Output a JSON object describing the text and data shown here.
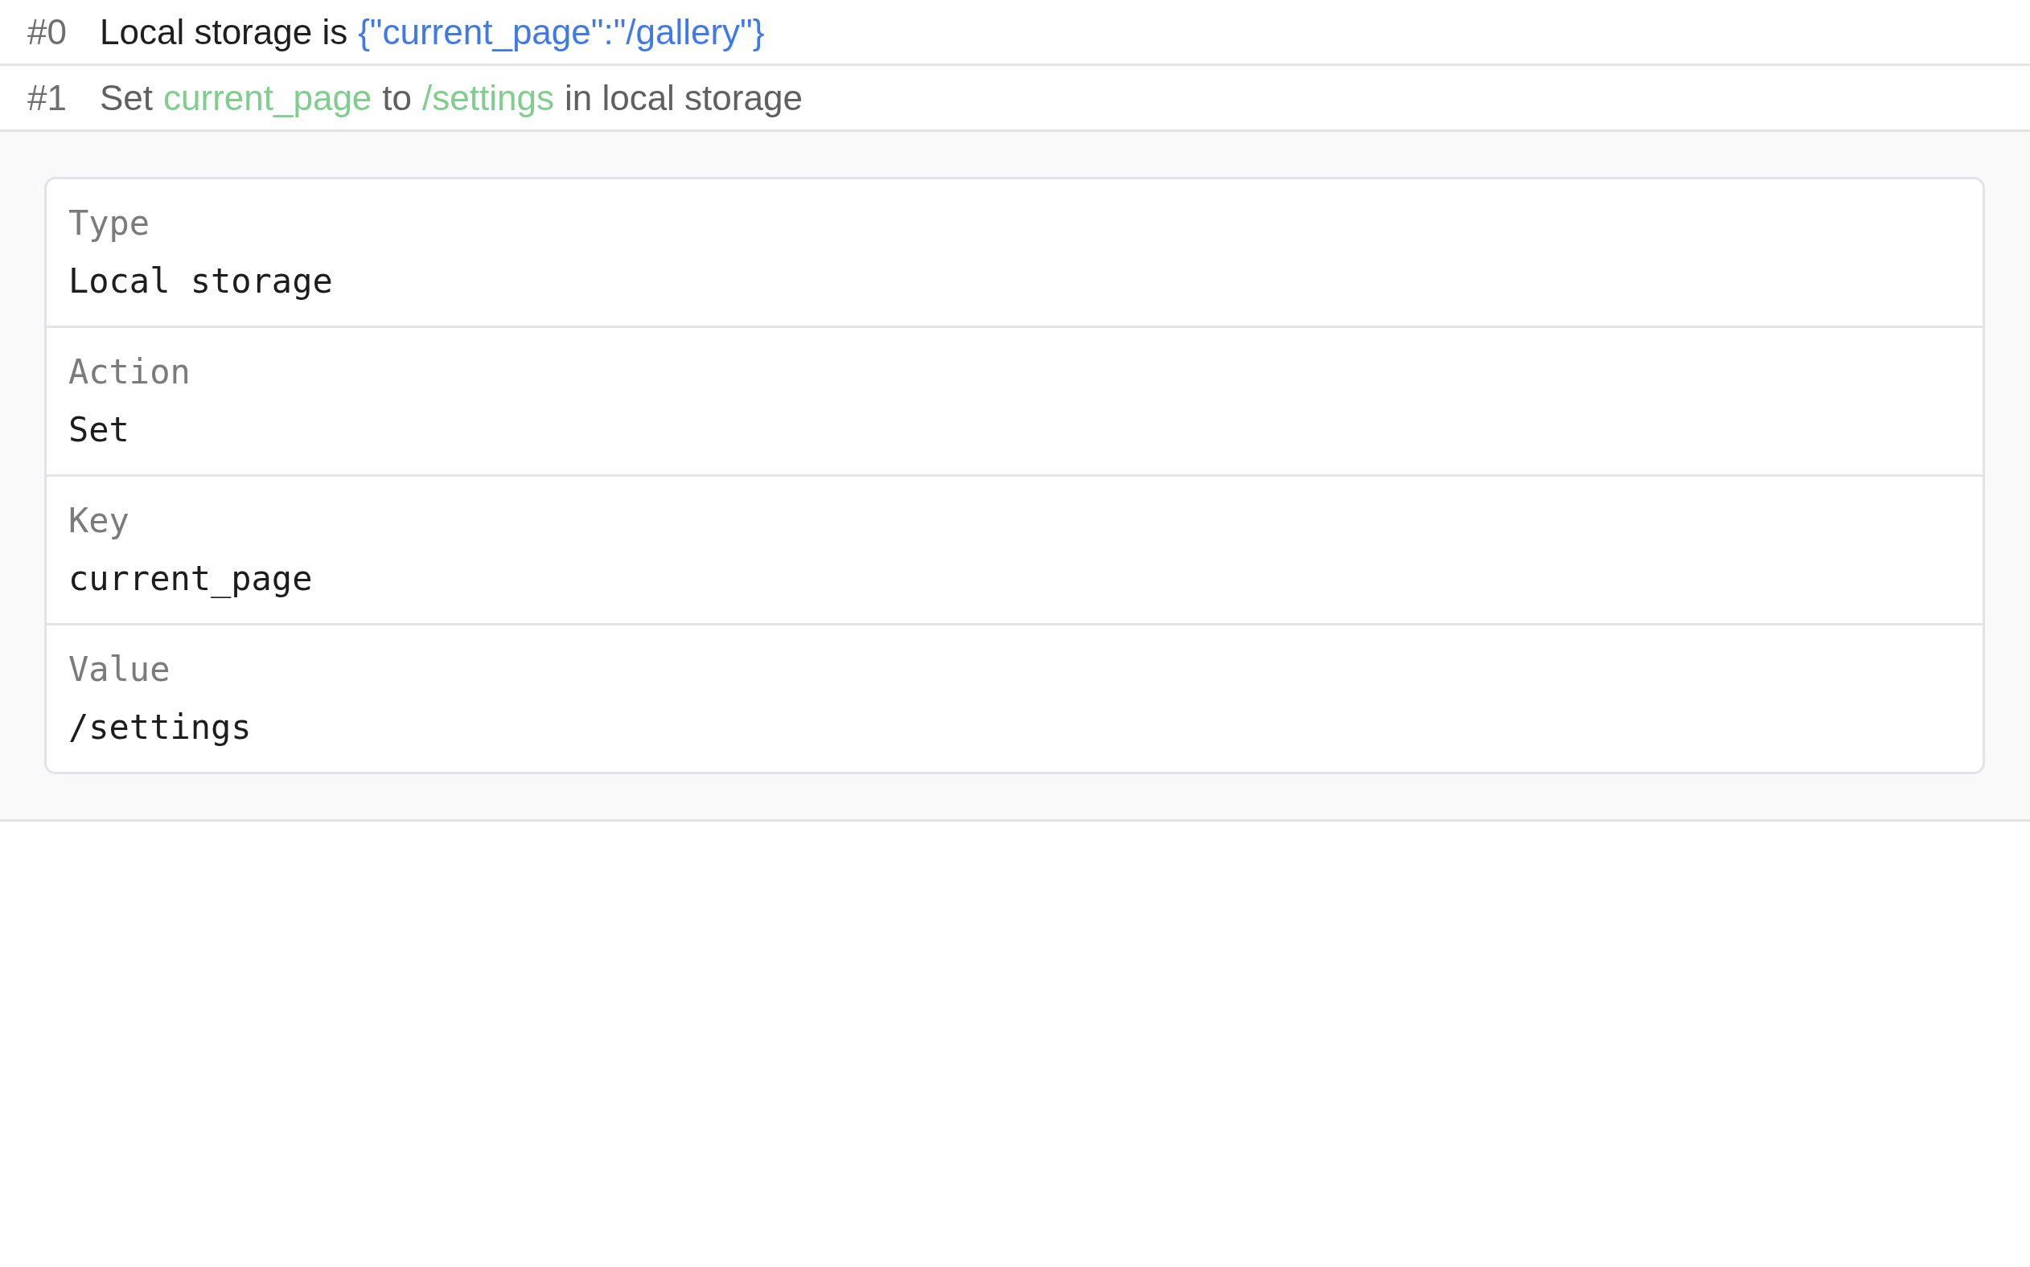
{
  "steps": [
    {
      "index": "#0",
      "kind": "state",
      "segments": [
        {
          "text": "Local storage is"
        },
        {
          "text": "{\"current_page\":\"/gallery\"}",
          "color": "#3f7ae8"
        }
      ]
    },
    {
      "index": "#1",
      "kind": "action",
      "segments": [
        {
          "text": "Set"
        },
        {
          "text": "current_page",
          "color": "#7fce8e"
        },
        {
          "text": "to"
        },
        {
          "text": "/settings",
          "color": "#7fce8e"
        },
        {
          "text": "in local storage"
        }
      ],
      "details": [
        {
          "label": "Type",
          "value": "Local storage"
        },
        {
          "label": "Action",
          "value": "Set"
        },
        {
          "label": "Key",
          "value": "current_page"
        },
        {
          "label": "Value",
          "value": "/settings"
        }
      ]
    }
  ]
}
